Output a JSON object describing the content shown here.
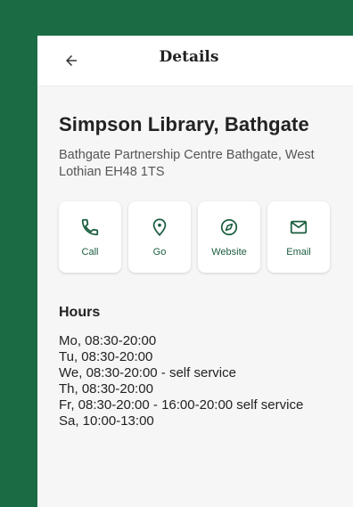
{
  "header": {
    "title": "Details"
  },
  "library": {
    "name": "Simpson Library, Bathgate",
    "address": "Bathgate Partnership Centre Bathgate, West Lothian EH48 1TS"
  },
  "actions": [
    {
      "label": "Call",
      "icon": "phone-icon"
    },
    {
      "label": "Go",
      "icon": "location-pin-icon"
    },
    {
      "label": "Website",
      "icon": "compass-icon"
    },
    {
      "label": "Email",
      "icon": "mail-icon"
    }
  ],
  "hours": {
    "heading": "Hours",
    "lines": [
      "Mo, 08:30-20:00",
      "Tu, 08:30-20:00",
      "We, 08:30-20:00 - self service",
      "Th, 08:30-20:00",
      "Fr, 08:30-20:00 - 16:00-20:00 self service",
      "Sa, 10:00-13:00"
    ]
  },
  "colors": {
    "brand": "#1b6b45",
    "icon": "#1b5e3f",
    "background": "#f6f6f6"
  }
}
